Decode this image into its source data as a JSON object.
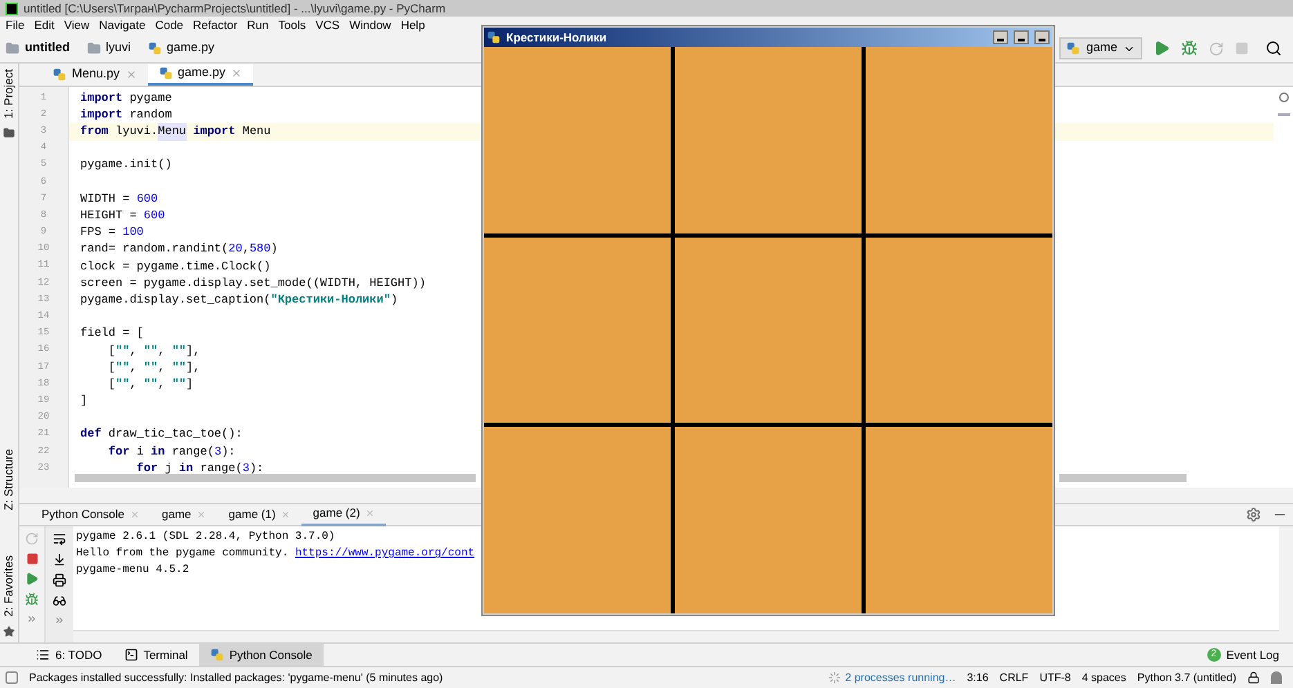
{
  "window": {
    "title": "untitled [C:\\Users\\Тигран\\PycharmProjects\\untitled] - ...\\lyuvi\\game.py - PyCharm"
  },
  "menu": [
    "File",
    "Edit",
    "View",
    "Navigate",
    "Code",
    "Refactor",
    "Run",
    "Tools",
    "VCS",
    "Window",
    "Help"
  ],
  "breadcrumbs": [
    {
      "kind": "project",
      "label": "untitled"
    },
    {
      "kind": "folder",
      "label": "lyuvi"
    },
    {
      "kind": "file",
      "label": "game.py"
    }
  ],
  "run_config": {
    "label": "game"
  },
  "left_tool_tabs": [
    "1: Project",
    "Z: Structure",
    "2: Favorites"
  ],
  "editor_tabs": [
    {
      "label": "Menu.py",
      "selected": false
    },
    {
      "label": "game.py",
      "selected": true
    }
  ],
  "code_lines": [
    {
      "number": "1",
      "current": false,
      "tokens": [
        {
          "kind": "keyword",
          "text": "import"
        },
        {
          "kind": "plain",
          "text": " pygame"
        }
      ]
    },
    {
      "number": "2",
      "current": false,
      "tokens": [
        {
          "kind": "keyword",
          "text": "import"
        },
        {
          "kind": "plain",
          "text": " random"
        }
      ]
    },
    {
      "number": "3",
      "current": true,
      "tokens": [
        {
          "kind": "keyword",
          "text": "from"
        },
        {
          "kind": "plain",
          "text": " lyuvi."
        },
        {
          "kind": "highlight",
          "text": "Menu"
        },
        {
          "kind": "keyword",
          "text": " import"
        },
        {
          "kind": "plain",
          "text": " Menu"
        }
      ]
    },
    {
      "number": "4",
      "current": false
    },
    {
      "number": "5",
      "current": false,
      "tokens": [
        {
          "kind": "plain",
          "text": "pygame.init()"
        }
      ]
    },
    {
      "number": "6",
      "current": false
    },
    {
      "number": "7",
      "current": false,
      "tokens": [
        {
          "kind": "plain",
          "text": "WIDTH = "
        },
        {
          "kind": "number",
          "text": "600"
        }
      ]
    },
    {
      "number": "8",
      "current": false,
      "tokens": [
        {
          "kind": "plain",
          "text": "HEIGHT = "
        },
        {
          "kind": "number",
          "text": "600"
        }
      ]
    },
    {
      "number": "9",
      "current": false,
      "tokens": [
        {
          "kind": "plain",
          "text": "FPS = "
        },
        {
          "kind": "number",
          "text": "100"
        }
      ]
    },
    {
      "number": "10",
      "current": false,
      "tokens": [
        {
          "kind": "plain",
          "text": "rand= random.randint("
        },
        {
          "kind": "number",
          "text": "20"
        },
        {
          "kind": "plain",
          "text": ","
        },
        {
          "kind": "number",
          "text": "580"
        },
        {
          "kind": "plain",
          "text": ")"
        }
      ]
    },
    {
      "number": "11",
      "current": false,
      "tokens": [
        {
          "kind": "plain",
          "text": "clock = pygame.time.Clock()"
        }
      ]
    },
    {
      "number": "12",
      "current": false,
      "tokens": [
        {
          "kind": "plain",
          "text": "screen = pygame.display.set_mode((WIDTH, HEIGHT))"
        }
      ]
    },
    {
      "number": "13",
      "current": false,
      "tokens": [
        {
          "kind": "plain",
          "text": "pygame.display.set_caption("
        },
        {
          "kind": "string",
          "text": "\"Крестики-Нолики\""
        },
        {
          "kind": "plain",
          "text": ")"
        }
      ]
    },
    {
      "number": "14",
      "current": false
    },
    {
      "number": "15",
      "current": false,
      "tokens": [
        {
          "kind": "plain",
          "text": "field = ["
        }
      ]
    },
    {
      "number": "16",
      "current": false,
      "tokens": [
        {
          "kind": "plain",
          "text": "    ["
        },
        {
          "kind": "string",
          "text": "\"\""
        },
        {
          "kind": "plain",
          "text": ", "
        },
        {
          "kind": "string",
          "text": "\"\""
        },
        {
          "kind": "plain",
          "text": ", "
        },
        {
          "kind": "string",
          "text": "\"\""
        },
        {
          "kind": "plain",
          "text": "],"
        }
      ]
    },
    {
      "number": "17",
      "current": false,
      "tokens": [
        {
          "kind": "plain",
          "text": "    ["
        },
        {
          "kind": "string",
          "text": "\"\""
        },
        {
          "kind": "plain",
          "text": ", "
        },
        {
          "kind": "string",
          "text": "\"\""
        },
        {
          "kind": "plain",
          "text": ", "
        },
        {
          "kind": "string",
          "text": "\"\""
        },
        {
          "kind": "plain",
          "text": "],"
        }
      ]
    },
    {
      "number": "18",
      "current": false,
      "tokens": [
        {
          "kind": "plain",
          "text": "    ["
        },
        {
          "kind": "string",
          "text": "\"\""
        },
        {
          "kind": "plain",
          "text": ", "
        },
        {
          "kind": "string",
          "text": "\"\""
        },
        {
          "kind": "plain",
          "text": ", "
        },
        {
          "kind": "string",
          "text": "\"\""
        },
        {
          "kind": "plain",
          "text": "]"
        }
      ]
    },
    {
      "number": "19",
      "current": false,
      "tokens": [
        {
          "kind": "plain",
          "text": "]"
        }
      ]
    },
    {
      "number": "20",
      "current": false
    },
    {
      "number": "21",
      "current": false,
      "tokens": [
        {
          "kind": "keyword",
          "text": "def"
        },
        {
          "kind": "plain",
          "text": " draw_tic_tac_toe():"
        }
      ]
    },
    {
      "number": "22",
      "current": false,
      "tokens": [
        {
          "kind": "keyword",
          "text": "    for"
        },
        {
          "kind": "plain",
          "text": " i "
        },
        {
          "kind": "keyword",
          "text": "in"
        },
        {
          "kind": "plain",
          "text": " range("
        },
        {
          "kind": "number",
          "text": "3"
        },
        {
          "kind": "plain",
          "text": "):"
        }
      ]
    },
    {
      "number": "23",
      "current": false,
      "tokens": [
        {
          "kind": "keyword",
          "text": "        for"
        },
        {
          "kind": "plain",
          "text": " j "
        },
        {
          "kind": "keyword",
          "text": "in"
        },
        {
          "kind": "plain",
          "text": " range("
        },
        {
          "kind": "number",
          "text": "3"
        },
        {
          "kind": "plain",
          "text": "):"
        }
      ]
    }
  ],
  "tool_tabs": [
    {
      "label": "Python Console",
      "selected": false
    },
    {
      "label": "game",
      "selected": false
    },
    {
      "label": "game (1)",
      "selected": false
    },
    {
      "label": "game (2)",
      "selected": true
    }
  ],
  "console_lines": [
    {
      "tokens": [
        {
          "kind": "plain",
          "text": "pygame 2.6.1 (SDL 2.28.4, Python 3.7.0)"
        }
      ]
    },
    {
      "tokens": [
        {
          "kind": "plain",
          "text": "Hello from the pygame community. "
        },
        {
          "kind": "link",
          "text": "https://www.pygame.org/cont"
        }
      ]
    },
    {
      "tokens": [
        {
          "kind": "plain",
          "text": "pygame-menu 4.5.2"
        }
      ]
    }
  ],
  "bottom_tabs": [
    {
      "kind": "todo",
      "label": "6: TODO",
      "selected": false
    },
    {
      "kind": "terminal",
      "label": "Terminal",
      "selected": false
    },
    {
      "kind": "console",
      "label": "Python Console",
      "selected": true
    }
  ],
  "event_log": {
    "count": "2",
    "label": "Event Log"
  },
  "status_bar": {
    "message": "Packages installed successfully: Installed packages: 'pygame-menu' (5 minutes ago)",
    "processes": "2 processes running…",
    "items": [
      "3:16",
      "CRLF",
      "UTF-8",
      "4 spaces",
      "Python 3.7 (untitled)"
    ]
  },
  "game_window": {
    "title": "Крестики-Нолики"
  }
}
